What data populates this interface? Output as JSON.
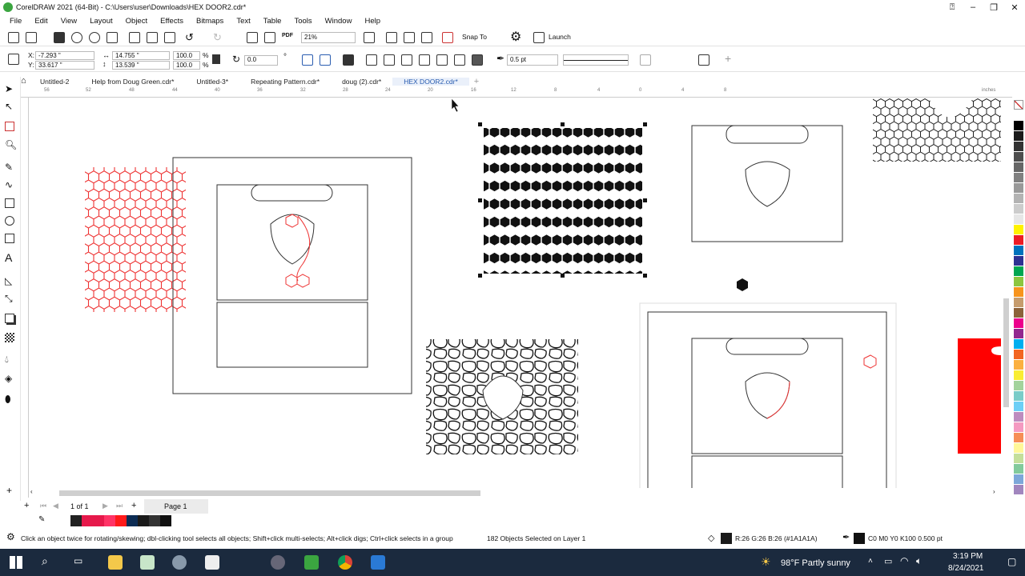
{
  "window": {
    "title": "CorelDRAW 2021 (64-Bit) - C:\\Users\\user\\Downloads\\HEX DOOR2.cdr*"
  },
  "menu": [
    "File",
    "Edit",
    "View",
    "Layout",
    "Object",
    "Effects",
    "Bitmaps",
    "Text",
    "Table",
    "Tools",
    "Window",
    "Help"
  ],
  "toolbar": {
    "zoom": "21%",
    "snap_label": "Snap To",
    "launch_label": "Launch"
  },
  "properties": {
    "x_label": "X:",
    "x": "-7.293 \"",
    "y_label": "Y:",
    "y": "33.617 \"",
    "w": "14.755 \"",
    "h": "13.539 \"",
    "scale_w": "100.0",
    "scale_h": "100.0",
    "unit_pct": "%",
    "rotation": "0.0",
    "outline_width": "0.5 pt"
  },
  "tabs": [
    "Untitled-2",
    "Help from Doug Green.cdr*",
    "Untitled-3*",
    "Repeating Pattern.cdr*",
    "doug (2).cdr*",
    "HEX DOOR2.cdr*"
  ],
  "active_tab": 5,
  "ruler": {
    "ticks": [
      "56",
      "52",
      "48",
      "44",
      "40",
      "36",
      "32",
      "28",
      "24",
      "20",
      "16",
      "12",
      "8",
      "4",
      "0",
      "4",
      "8"
    ],
    "unit": "inches"
  },
  "page_nav": {
    "page_of": "1 of 1",
    "page_tab": "Page 1"
  },
  "status": {
    "hint": "Click an object twice for rotating/skewing; dbl-clicking tool selects all objects; Shift+click multi-selects; Alt+click digs; Ctrl+click selects in a group",
    "selection": "182 Objects Selected on Layer 1",
    "fill": "R:26 G:26 B:26 (#1A1A1A)",
    "outline": "C0 M0 Y0 K100  0.500 pt"
  },
  "taskbar": {
    "weather": "98°F  Partly sunny",
    "time": "3:19 PM",
    "date": "8/24/2021"
  },
  "palette_colors": [
    "#ffffff",
    "#000000",
    "#1a1a1a",
    "#333333",
    "#4d4d4d",
    "#666666",
    "#808080",
    "#999999",
    "#b3b3b3",
    "#cccccc",
    "#e6e6e6",
    "#fff200",
    "#ed1c24",
    "#0072bc",
    "#2e3192",
    "#00a651",
    "#8dc63f",
    "#f7941d",
    "#c69c6d",
    "#8c6239",
    "#ec008c",
    "#92278f",
    "#00aeef",
    "#f26522",
    "#fbb040",
    "#f9ed32",
    "#a3d39c",
    "#7accc8",
    "#6dcff6",
    "#bd8cbf",
    "#f49ac1",
    "#f68e56",
    "#fff799",
    "#c4df9b",
    "#82ca9c",
    "#7da7d9",
    "#a186be"
  ],
  "doc_palette": [
    "#ffffff",
    "#222222",
    "#e6194b",
    "#e6194b",
    "#ff3366",
    "#ff1a1a",
    "#0d2c54",
    "#1a1a1a",
    "#333333",
    "#111111"
  ]
}
